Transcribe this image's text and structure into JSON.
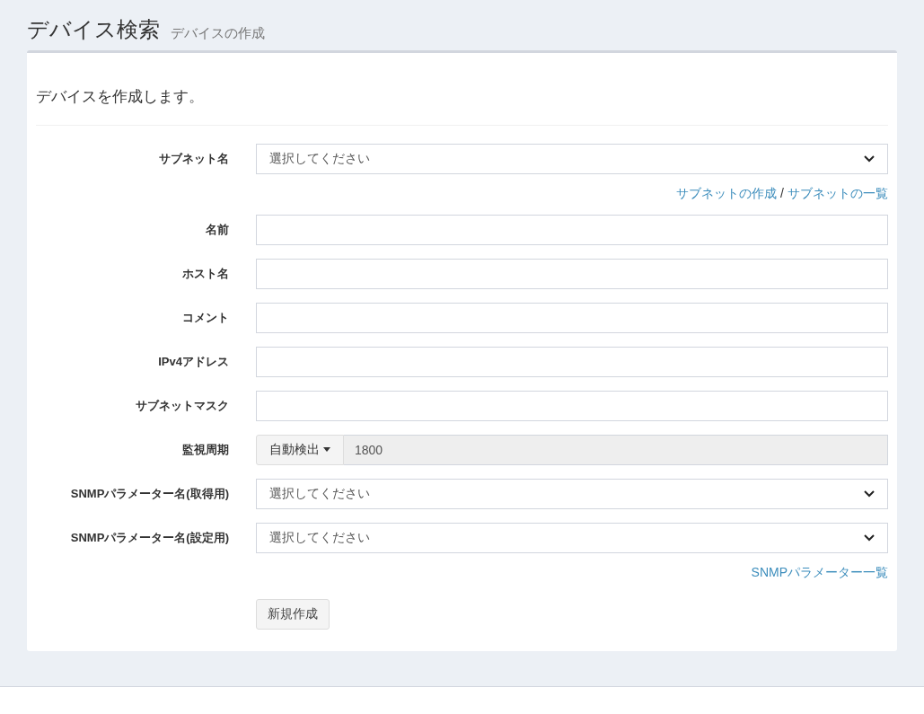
{
  "header": {
    "title": "デバイス検索",
    "subtitle": "デバイスの作成"
  },
  "intro": "デバイスを作成します。",
  "fields": [
    {
      "kind": "select",
      "label": "サブネット名",
      "value": "選択してください",
      "links": [
        {
          "text": "サブネットの作成"
        },
        {
          "text": "サブネットの一覧"
        }
      ],
      "separator": "/"
    },
    {
      "kind": "text",
      "label": "名前"
    },
    {
      "kind": "text",
      "label": "ホスト名"
    },
    {
      "kind": "text",
      "label": "コメント"
    },
    {
      "kind": "text",
      "label": "IPv4アドレス"
    },
    {
      "kind": "text",
      "label": "サブネットマスク"
    },
    {
      "kind": "addon",
      "label": "監視周期",
      "button": "自動検出",
      "value": "1800",
      "disabled": true
    },
    {
      "kind": "select",
      "label": "SNMPパラメーター名(取得用)",
      "value": "選択してください"
    },
    {
      "kind": "select",
      "label": "SNMPパラメーター名(設定用)",
      "value": "選択してください",
      "links": [
        {
          "text": "SNMPパラメーター一覧"
        }
      ]
    }
  ],
  "submit": "新規作成"
}
